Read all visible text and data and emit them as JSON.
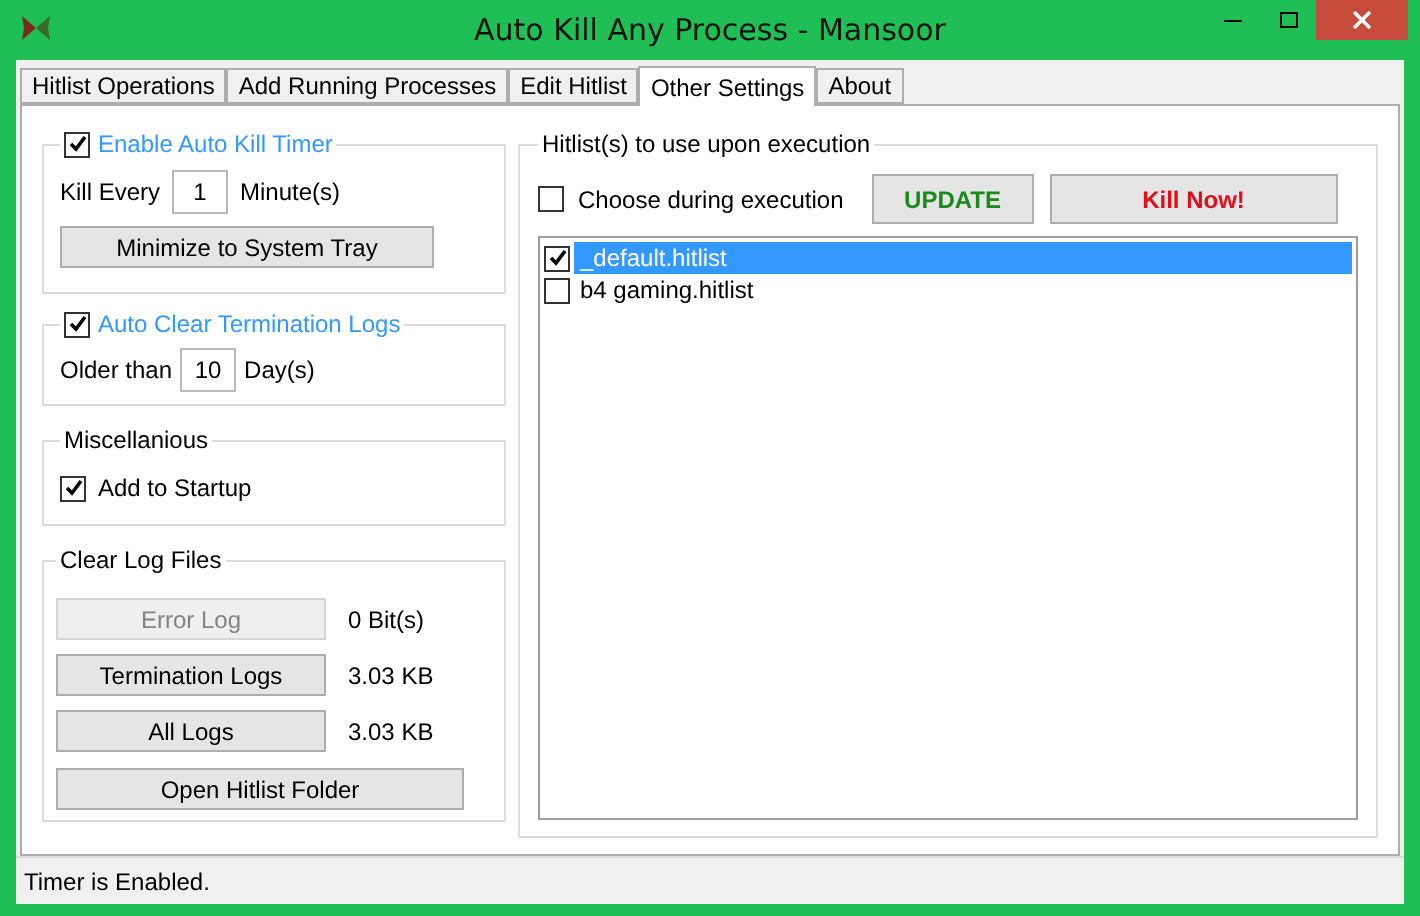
{
  "window": {
    "title": "Auto Kill Any Process - Mansoor"
  },
  "tabs": [
    {
      "label": "Hitlist Operations",
      "selected": false
    },
    {
      "label": "Add Running Processes",
      "selected": false
    },
    {
      "label": "Edit Hitlist",
      "selected": false
    },
    {
      "label": "Other Settings",
      "selected": true
    },
    {
      "label": "About",
      "selected": false
    }
  ],
  "auto_kill_timer": {
    "label": "Enable Auto Kill Timer",
    "checked": true,
    "prefix": "Kill Every",
    "value": "1",
    "unit": "Minute(s)",
    "button": "Minimize to System Tray"
  },
  "auto_clear_logs": {
    "label": "Auto Clear Termination Logs",
    "checked": true,
    "prefix": "Older than",
    "value": "10",
    "unit": "Day(s)"
  },
  "miscellaneous": {
    "title": "Miscellanious",
    "startup": {
      "label": "Add to Startup",
      "checked": true
    }
  },
  "clear_log_files": {
    "title": "Clear Log Files",
    "rows": [
      {
        "button": "Error Log",
        "size": "0 Bit(s)",
        "disabled": true
      },
      {
        "button": "Termination Logs",
        "size": "3.03 KB",
        "disabled": false
      },
      {
        "button": "All Logs",
        "size": "3.03 KB",
        "disabled": false
      }
    ],
    "open_button": "Open Hitlist Folder"
  },
  "hitlists": {
    "title": "Hitlist(s) to use upon execution",
    "choose": {
      "label": "Choose during execution",
      "checked": false
    },
    "update_button": "UPDATE",
    "kill_button": "Kill Now!",
    "items": [
      {
        "label": "_default.hitlist",
        "checked": true,
        "selected": true
      },
      {
        "label": "b4 gaming.hitlist",
        "checked": false,
        "selected": false
      }
    ]
  },
  "status_bar": "Timer is Enabled."
}
